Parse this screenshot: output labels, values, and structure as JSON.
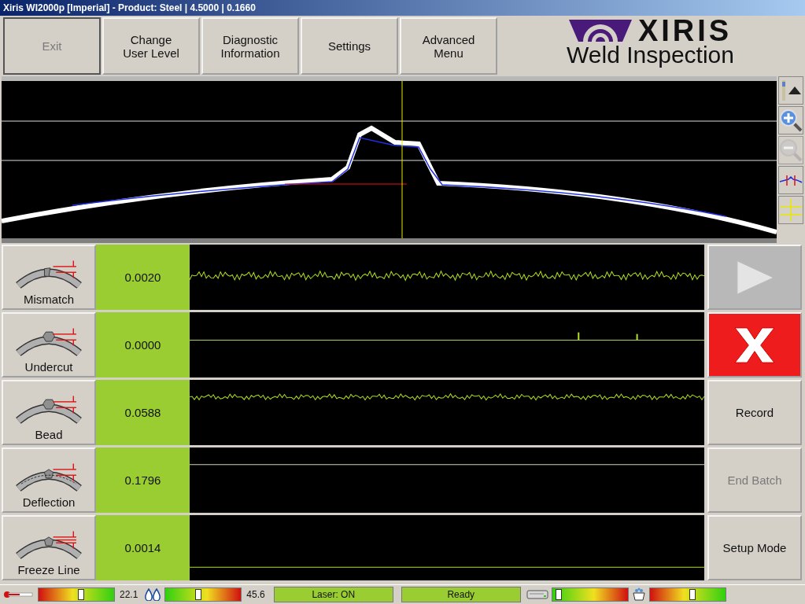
{
  "window": {
    "title": "Xiris WI2000p [Imperial] - Product: Steel | 4.5000 | 0.1660"
  },
  "top_buttons": [
    {
      "label": "Exit",
      "disabled": true
    },
    {
      "label": "Change User Level",
      "disabled": false
    },
    {
      "label": "Diagnostic Information",
      "disabled": false
    },
    {
      "label": "Settings",
      "disabled": false
    },
    {
      "label": "Advanced Menu",
      "disabled": false
    }
  ],
  "logo": {
    "brand": "XIRIS",
    "subtitle": "Weld Inspection"
  },
  "view_tools": [
    {
      "kind": "scroll",
      "disabled": false
    },
    {
      "kind": "zoom_in",
      "disabled": false
    },
    {
      "kind": "zoom_out",
      "disabled": true
    },
    {
      "kind": "profile",
      "disabled": false
    },
    {
      "kind": "crosshair",
      "disabled": false
    }
  ],
  "measurements": [
    {
      "kind": "mismatch",
      "name": "Mismatch",
      "value": "0.0020"
    },
    {
      "kind": "undercut",
      "name": "Undercut",
      "value": "0.0000"
    },
    {
      "kind": "bead",
      "name": "Bead",
      "value": "0.0588"
    },
    {
      "kind": "deflection",
      "name": "Deflection",
      "value": "0.1796"
    },
    {
      "kind": "freeze",
      "name": "Freeze Line",
      "value": "0.0014"
    }
  ],
  "actions": [
    {
      "kind": "play",
      "disabled": true
    },
    {
      "kind": "reject",
      "disabled": false
    },
    {
      "kind": "text",
      "label": "Record",
      "disabled": false
    },
    {
      "kind": "text",
      "label": "End Batch",
      "disabled": true
    },
    {
      "kind": "text",
      "label": "Setup Mode",
      "disabled": false
    }
  ],
  "status_bar": [
    {
      "kind": "thermometer"
    },
    {
      "kind": "gauge_rg",
      "level": 0.55
    },
    {
      "kind": "reading",
      "text": "22.1"
    },
    {
      "kind": "droplets"
    },
    {
      "kind": "gauge_gr",
      "level": 0.42
    },
    {
      "kind": "reading",
      "text": "45.6"
    },
    {
      "kind": "panel",
      "text": "Laser: ON"
    },
    {
      "kind": "panel",
      "text": "Ready"
    },
    {
      "kind": "drive"
    },
    {
      "kind": "gauge_gr",
      "level": 0.08
    },
    {
      "kind": "fan"
    },
    {
      "kind": "gauge_rg",
      "level": 0.55
    }
  ]
}
